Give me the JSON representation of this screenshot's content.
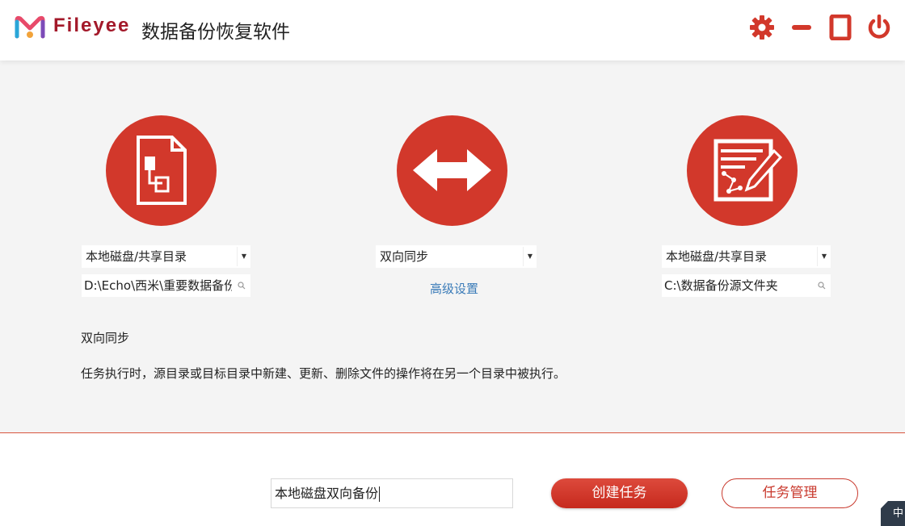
{
  "header": {
    "brand": "Fileyee",
    "title": "数据备份恢复软件",
    "colors": {
      "brand": "#a3192a",
      "accent": "#d2382b"
    },
    "buttons": [
      {
        "icon": "gear-icon"
      },
      {
        "icon": "minimize-icon"
      },
      {
        "icon": "maximize-icon"
      },
      {
        "icon": "power-icon"
      }
    ]
  },
  "source": {
    "icon": "document-flowchart-icon",
    "type_selected": "本地磁盘/共享目录",
    "path": "D:\\Echo\\西米\\重要数据备份"
  },
  "sync": {
    "icon": "double-arrow-icon",
    "mode_selected": "双向同步",
    "advanced_link": "高级设置"
  },
  "target": {
    "icon": "edit-document-icon",
    "type_selected": "本地磁盘/共享目录",
    "path": "C:\\数据备份源文件夹"
  },
  "mode_info": {
    "title": "双向同步",
    "description": "任务执行时，源目录或目标目录中新建、更新、删除文件的操作将在另一个目录中被执行。"
  },
  "footer": {
    "task_name": "本地磁盘双向备份",
    "create_label": "创建任务",
    "manage_label": "任务管理"
  },
  "ime_indicator": "中"
}
